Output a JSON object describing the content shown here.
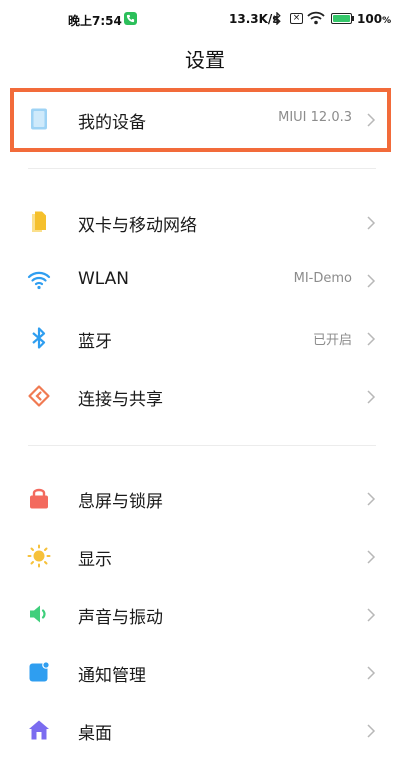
{
  "status_bar": {
    "time": "晚上7:54",
    "speed": "13.3K/s",
    "battery": "100",
    "battery_unit": "%"
  },
  "header": {
    "title": "设置"
  },
  "device": {
    "label": "我的设备",
    "value": "MIUI 12.0.3"
  },
  "network_items": [
    {
      "label": "双卡与移动网络",
      "value": ""
    },
    {
      "label": "WLAN",
      "value": "MI-Demo"
    },
    {
      "label": "蓝牙",
      "value": "已开启"
    },
    {
      "label": "连接与共享",
      "value": ""
    }
  ],
  "system_items": [
    {
      "label": "息屏与锁屏"
    },
    {
      "label": "显示"
    },
    {
      "label": "声音与振动"
    },
    {
      "label": "通知管理"
    },
    {
      "label": "桌面"
    }
  ],
  "colors": {
    "highlight": "#f26b3a",
    "sim": "#f5c02c",
    "wifi": "#2f9ef0",
    "bluetooth": "#2f9ef0",
    "share": "#f07a52",
    "lock": "#f36a5e",
    "display": "#f6c13a",
    "sound": "#3fcf7c",
    "notification": "#2f9ef0",
    "home": "#7b6cf0"
  }
}
